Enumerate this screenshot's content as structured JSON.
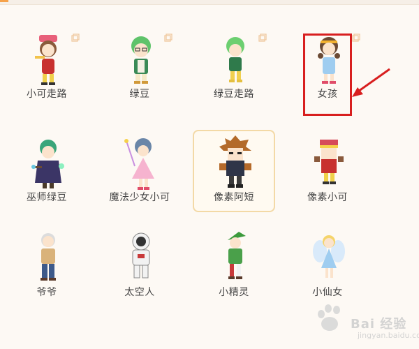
{
  "characters": [
    {
      "label": "小可走路"
    },
    {
      "label": "绿豆"
    },
    {
      "label": "绿豆走路"
    },
    {
      "label": "女孩"
    },
    {
      "label": "巫师绿豆"
    },
    {
      "label": "魔法少女小可"
    },
    {
      "label": "像素阿短"
    },
    {
      "label": "像素小可"
    },
    {
      "label": "爷爷"
    },
    {
      "label": "太空人"
    },
    {
      "label": "小精灵"
    },
    {
      "label": "小仙女"
    }
  ],
  "selected_index": 6,
  "highlighted_index": 3,
  "colors": {
    "selection_border": "#f3d9a6",
    "annotation_red": "#d81f1f",
    "accent_orange": "#f6a24a",
    "copy_icon": "#f0c9a0"
  },
  "watermark": {
    "text": "Bai 经验",
    "sub": "jingyan.baidu.com"
  }
}
